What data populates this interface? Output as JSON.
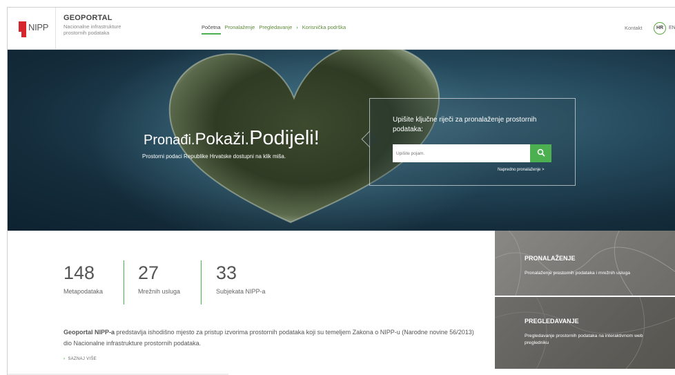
{
  "header": {
    "logo_text": "NIPP",
    "brand_title": "GEOPORTAL",
    "brand_subtitle": "Nacionalne infrastrukture prostornih podataka",
    "nav": {
      "home": "Početna",
      "search": "Pronalaženje",
      "browse": "Pregledavanje",
      "support": "Korisnička podrška"
    },
    "contact": "Kontakt",
    "lang_active": "HR",
    "lang_other": "EN"
  },
  "hero": {
    "title_part1": "Pronađi.",
    "title_part2": "Pokaži.",
    "title_part3": "Podijeli!",
    "subtitle": "Prostorni podaci Republike Hrvatske dostupni na klik miša.",
    "search_heading": "Upišite ključne riječi za pronalaženje prostornih podataka:",
    "search_placeholder": "Upišite pojam.",
    "advanced_link": "Napredno pronalaženje >"
  },
  "stats": [
    {
      "value": "148",
      "label": "Metapodataka"
    },
    {
      "value": "27",
      "label": "Mrežnih usluga"
    },
    {
      "value": "33",
      "label": "Subjekata NIPP-a"
    }
  ],
  "intro": {
    "bold": "Geoportal NIPP-a",
    "text": " predstavlja ishodišno mjesto za pristup izvorima prostornih podataka koji su temeljem Zakona o NIPP-u (Narodne novine 56/2013) dio Nacionalne infrastrukture prostornih podataka.",
    "more_link": "SAZNAJ VIŠE"
  },
  "tiles": [
    {
      "title": "PRONALAŽENJE",
      "text": "Pronalaženje prostornih podataka i mrežnih usluga"
    },
    {
      "title": "PREGLEDAVANJE",
      "text": "Pregledavanje prostornih podataka na interaktivnom web pregledniku"
    }
  ],
  "colors": {
    "accent": "#4caf50",
    "logo_red": "#d6252c"
  }
}
